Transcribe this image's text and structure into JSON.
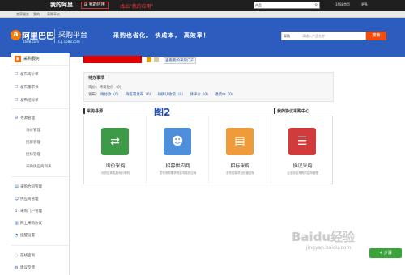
{
  "topbar": {
    "logo": "我的阿里",
    "my_app": "我的应用",
    "annotation": "找出\"我的应用\"",
    "search_dropdown": "产品",
    "search_placeholder": "",
    "cart": "1688首页",
    "more": "更多"
  },
  "subnav": {
    "items": [
      "卖家服务",
      "我的",
      "采购平台",
      "",
      "",
      "",
      "",
      "",
      "",
      ""
    ]
  },
  "header": {
    "brand": "阿里巴巴",
    "brand_url": "1688.com",
    "platform": "采购平台",
    "platform_url": "Cg.1688.com",
    "slogan": "采购也省化。 快成本， 高效率！",
    "search_dropdown": "采购",
    "search_placeholder": "请输入产品名称",
    "search_button": "搜索"
  },
  "sidebar": {
    "title": "采购服务",
    "items": [
      "发布询价单",
      "发布需求书",
      "发布招标单",
      "寻源管理"
    ],
    "sub_items": [
      "询价管理",
      "招募管理",
      "招标管理",
      "采购供应商列表"
    ],
    "items2": [
      "采购合同管理",
      "供应商管理",
      "采购门户管理",
      "网上采购协议",
      "提醒设置"
    ],
    "items3": [
      "在线咨询",
      "建议反馈"
    ]
  },
  "main": {
    "my_page_link": "查看我的采购门户",
    "todo_title": "待办事项",
    "todo_line1": "询价：待发放价（0）",
    "todo_line2_label": "发布：",
    "todo_links": [
      "待付款（0）",
      "待签署发布（0）",
      "待确认收货（0）",
      "待评价（0）",
      "退货中（0）"
    ],
    "section_left": "采购寻源",
    "section_right": "我的协议采购中心",
    "figure_label": "图2",
    "cards": [
      {
        "label": "询价采购",
        "desc": "向供应商发起询价采购",
        "color": "#3d9a47",
        "icon": "document-arrows-icon"
      },
      {
        "label": "招募供应商",
        "desc": "发布采购需求快速寻找供应商",
        "color": "#4e8fdc",
        "icon": "people-icon"
      },
      {
        "label": "招标采购",
        "desc": "发布招标项目快速招标",
        "color": "#ef9b39",
        "icon": "printer-document-icon"
      },
      {
        "label": "协议采购",
        "desc": "企业协议采购供应商管理",
        "color": "#d23b3b",
        "icon": "document-lines-icon"
      }
    ]
  },
  "watermark": {
    "text": "Baidu经验",
    "url": "jingyan.baidu.com",
    "feedback_button": "+ 步骤"
  }
}
